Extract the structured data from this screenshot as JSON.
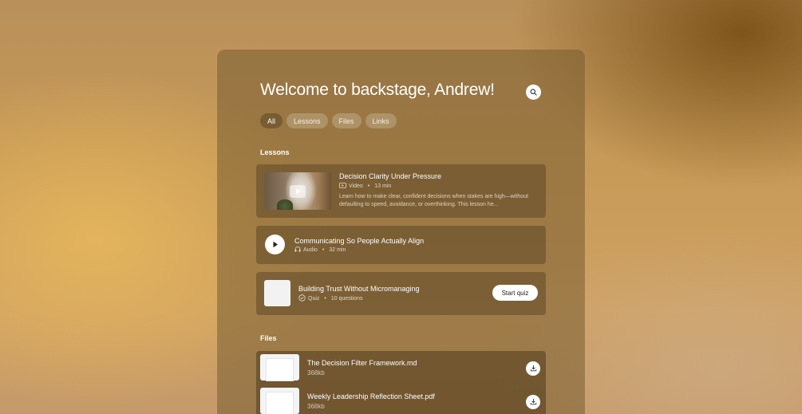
{
  "header": {
    "title": "Welcome to backstage,  Andrew!",
    "search_icon": "search-icon"
  },
  "filters": [
    {
      "label": "All",
      "active": true
    },
    {
      "label": "Lessons",
      "active": false
    },
    {
      "label": "Files",
      "active": false
    },
    {
      "label": "Links",
      "active": false
    }
  ],
  "lessons": {
    "section_label": "Lessons",
    "items": [
      {
        "title": "Decision Clarity Under Pressure",
        "type": "Video",
        "duration": "13 min",
        "description": "Learn how to make clear, confident decisions when stakes are high—without defaulting to speed, avoidance, or overthinking. This lesson he...",
        "icon": "video-icon"
      },
      {
        "title": "Communicating So People Actually Align",
        "type": "Audio",
        "duration": "32 min",
        "icon": "audio-icon"
      },
      {
        "title": "Building Trust Without Micromanaging",
        "type": "Quiz",
        "count": "10 questions",
        "action_label": "Start quiz",
        "icon": "quiz-check-icon"
      }
    ]
  },
  "files": {
    "section_label": "Files",
    "items": [
      {
        "name": "The Decision Filter Framework.md",
        "size": "368kb"
      },
      {
        "name": "Weekly Leadership Reflection Sheet.pdf",
        "size": "368kb"
      }
    ]
  },
  "separator": "•"
}
